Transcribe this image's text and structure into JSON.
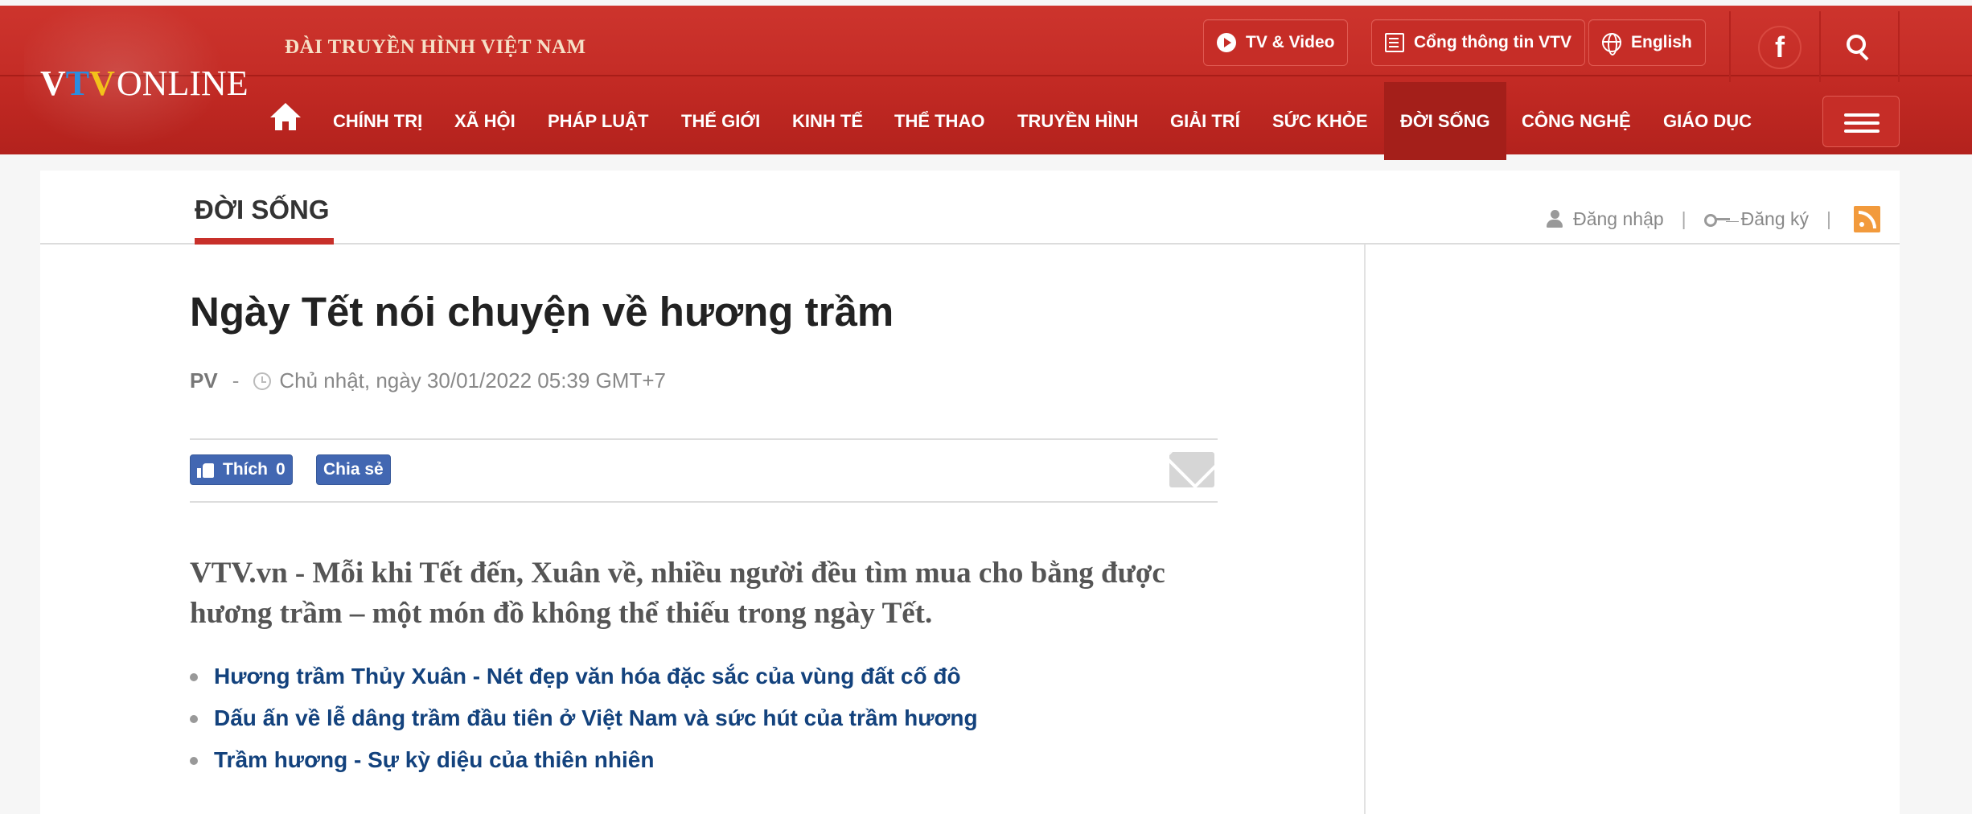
{
  "header": {
    "logo": {
      "v1": "V",
      "t": "T",
      "v2": "V",
      "online": "ONLINE"
    },
    "station_name": "ĐÀI TRUYỀN HÌNH VIỆT NAM",
    "top_buttons": {
      "tv_video": "TV & Video",
      "portal": "Cổng thông tin VTV",
      "english": "English"
    },
    "facebook_glyph": "f"
  },
  "nav": {
    "items": [
      {
        "label": "CHÍNH TRỊ"
      },
      {
        "label": "XÃ HỘI"
      },
      {
        "label": "PHÁP LUẬT"
      },
      {
        "label": "THẾ GIỚI"
      },
      {
        "label": "KINH TẾ"
      },
      {
        "label": "THỂ THAO"
      },
      {
        "label": "TRUYỀN HÌNH"
      },
      {
        "label": "GIẢI TRÍ"
      },
      {
        "label": "SỨC KHỎE"
      },
      {
        "label": "ĐỜI SỐNG"
      },
      {
        "label": "CÔNG NGHỆ"
      },
      {
        "label": "GIÁO DỤC"
      }
    ],
    "active": "ĐỜI SỐNG"
  },
  "section": {
    "title": "ĐỜI SỐNG",
    "login": "Đăng nhập",
    "register": "Đăng ký",
    "separator": "|"
  },
  "article": {
    "title": "Ngày Tết nói chuyện về hương trầm",
    "author": "PV",
    "byline_dash": "-",
    "date": "Chủ nhật, ngày 30/01/2022 05:39 GMT+7",
    "like_label": "Thích",
    "like_count": "0",
    "share_label": "Chia sẻ",
    "sapo": "VTV.vn - Mỗi khi Tết đến, Xuân về, nhiều người đều tìm mua cho bằng được hương trầm – một món đồ không thể thiếu trong ngày Tết.",
    "related": [
      "Hương trầm Thủy Xuân - Nét đẹp văn hóa đặc sắc của vùng đất cố đô",
      "Dấu ấn về lễ dâng trầm đầu tiên ở Việt Nam và sức hút của trầm hương",
      "Trầm hương - Sự kỳ diệu của thiên nhiên"
    ]
  },
  "colors": {
    "header_red": "#c62d27",
    "active_nav": "#a41f1a",
    "link_blue": "#13427d",
    "facebook_blue": "#4267b2",
    "rss_orange": "#f29a3c"
  }
}
